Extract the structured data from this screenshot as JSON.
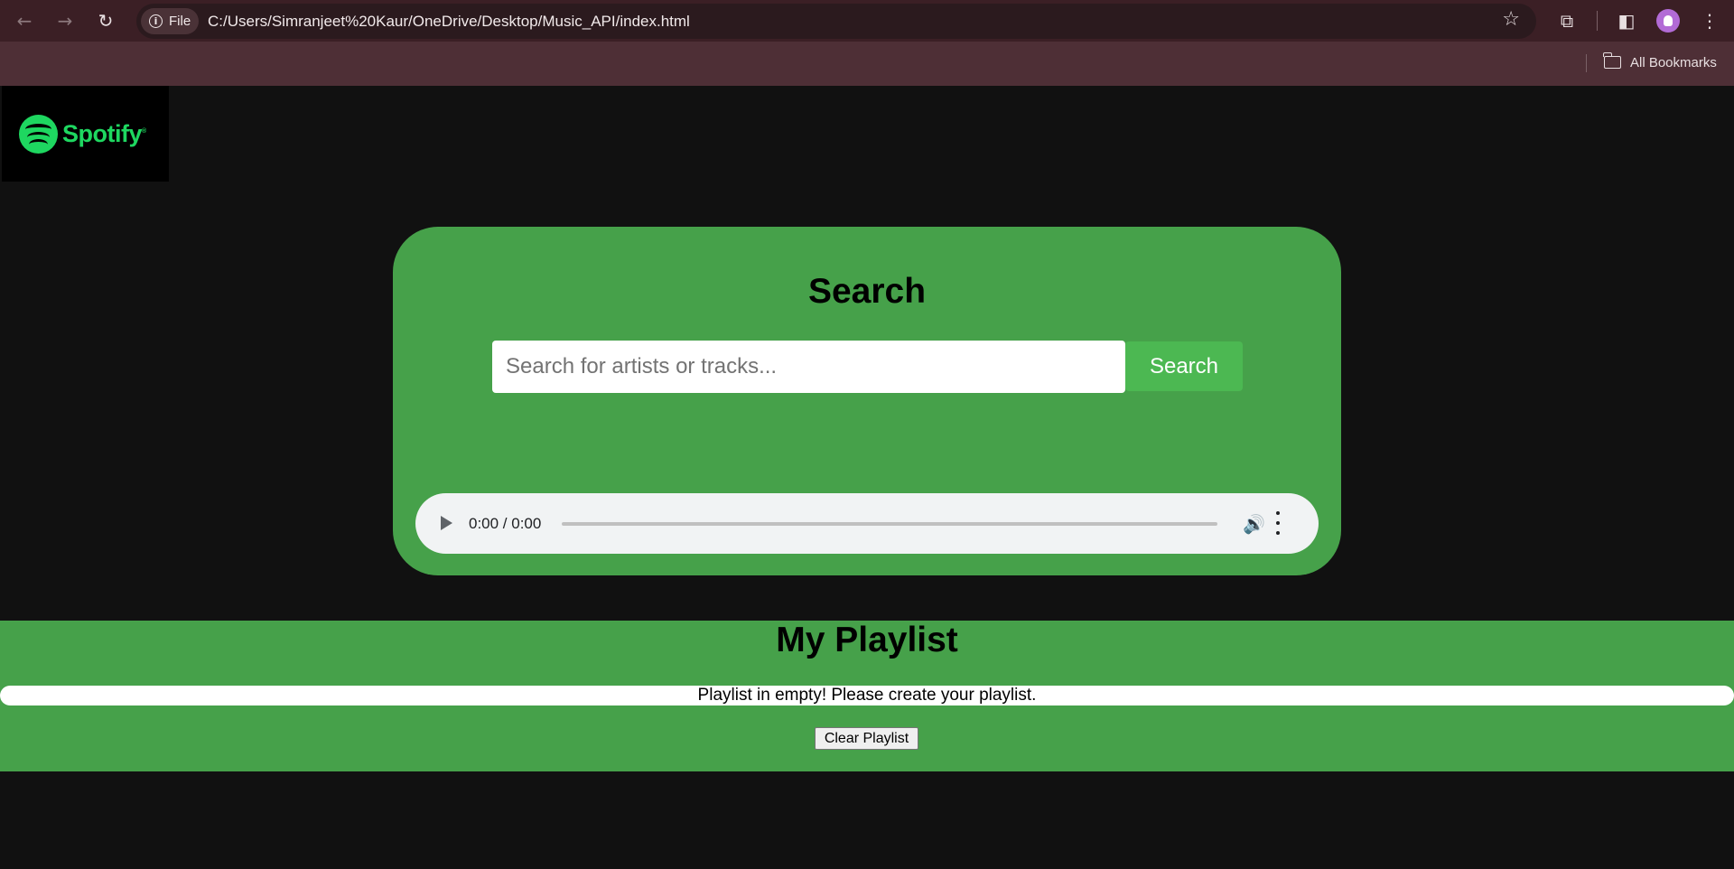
{
  "browser": {
    "url": "C:/Users/Simranjeet%20Kaur/OneDrive/Desktop/Music_API/index.html",
    "file_chip_label": "File",
    "bookmarks_label": "All Bookmarks",
    "icons": [
      "back-icon",
      "forward-icon",
      "reload-icon",
      "info-icon",
      "star-icon",
      "extensions-icon",
      "side-panel-icon",
      "profile-avatar",
      "more-icon",
      "folder-icon"
    ]
  },
  "logo": {
    "text": "Spotify",
    "reg_mark": "®"
  },
  "search": {
    "title": "Search",
    "placeholder": "Search for artists or tracks...",
    "value": "",
    "button_label": "Search"
  },
  "audio_player": {
    "time": "0:00 / 0:00",
    "progress": 0
  },
  "playlist": {
    "title": "My Playlist",
    "empty_message": "Playlist in empty! Please create your playlist.",
    "clear_button_label": "Clear Playlist"
  },
  "colors": {
    "brand_green": "#1ed760",
    "card_green": "#46a14a",
    "button_green": "#4cb852",
    "page_background": "#111111",
    "browser_toolbar": "#3b1f25"
  }
}
